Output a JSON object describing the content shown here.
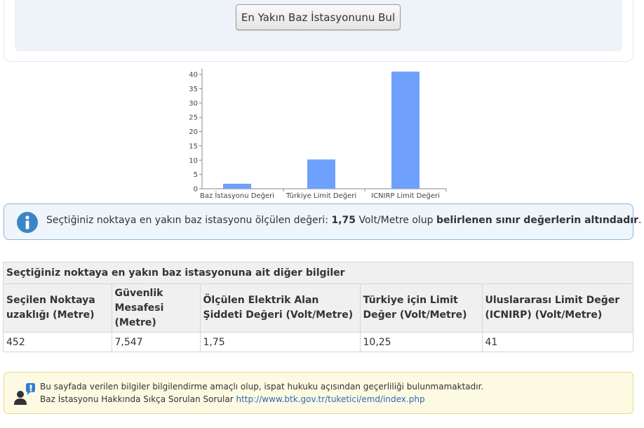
{
  "search": {
    "find_button_label": "En Yakın Baz İstasyonunu Bul"
  },
  "chart_data": {
    "type": "bar",
    "categories": [
      "Baz İstasyonu Değeri",
      "Türkiye Limit Değeri",
      "ICNIRP Limit Değeri"
    ],
    "values": [
      1.75,
      10.25,
      41
    ],
    "ylim": [
      0,
      42
    ],
    "yticks": [
      0,
      5,
      10,
      15,
      20,
      25,
      30,
      35,
      40
    ],
    "title": "",
    "xlabel": "",
    "ylabel": "",
    "grid": false,
    "bar_color": "#6fa0fb"
  },
  "info_alert": {
    "prefix": "Seçtiğiniz noktaya en yakın baz istasyonu ölçülen değeri: ",
    "value": "1,75",
    "unit_text": " Volt/Metre olup ",
    "conclusion": "belirlenen sınır değerlerin altındadır",
    "suffix": ".",
    "icon": "info-icon",
    "color": "#3a84c7"
  },
  "details_table": {
    "caption": "Seçtiğiniz noktaya en yakın baz istasyonuna ait diğer bilgiler",
    "headers": [
      "Seçilen Noktaya uzaklığı (Metre)",
      "Güvenlik Mesafesi (Metre)",
      "Ölçülen Elektrik Alan Şiddeti Değeri (Volt/Metre)",
      "Türkiye için Limit Değer (Volt/Metre)",
      "Uluslararası Limit Değer (ICNIRP) (Volt/Metre)"
    ],
    "row": [
      "452",
      "7,547",
      "1,75",
      "10,25",
      "41"
    ]
  },
  "disclaimer": {
    "line1": "Bu sayfada verilen bilgiler bilgilendirme amaçlı olup, ispat hukuku açısından geçerliliği bulunmamaktadır.",
    "line2_prefix": "Baz İstasyonu Hakkında Sıkça Sorulan Sorular ",
    "link_text": "http://www.btk.gov.tr/tuketici/emd/index.php",
    "icon": "user-alert-icon"
  }
}
